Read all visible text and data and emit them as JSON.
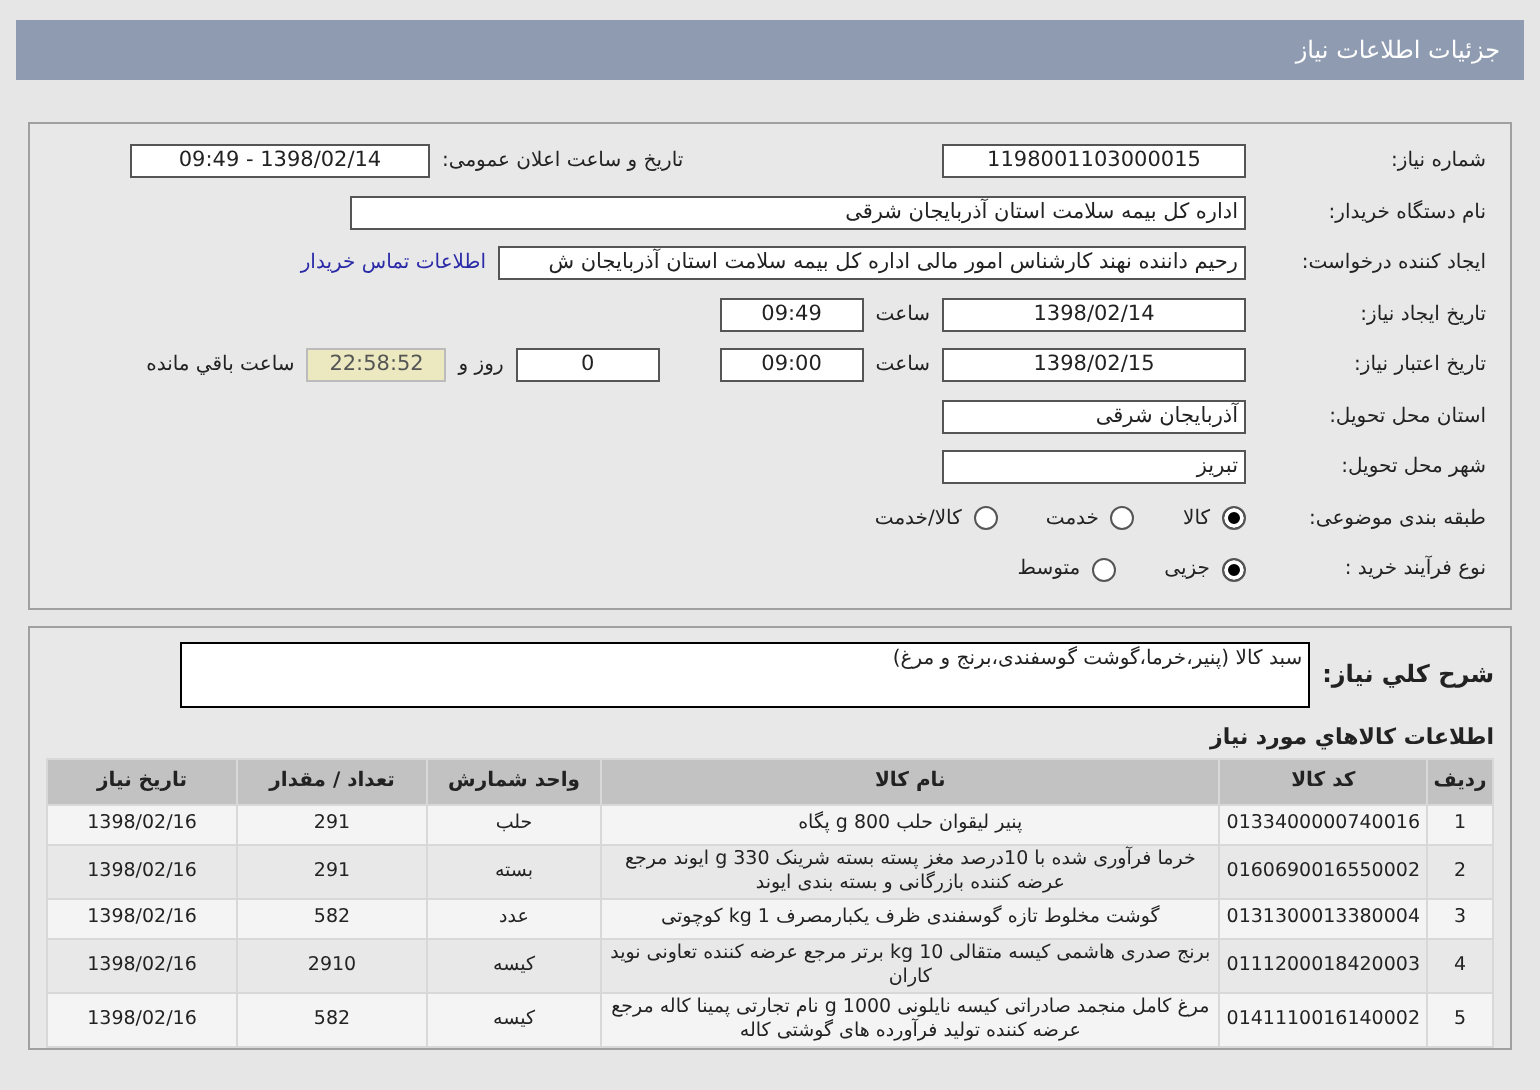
{
  "header": {
    "title": "جزئیات اطلاعات نیاز"
  },
  "details": {
    "need_number": {
      "label": "شماره نیاز:",
      "value": "1198001103000015"
    },
    "announce": {
      "label": "تاریخ و ساعت اعلان عمومی:",
      "value": "1398/02/14 - 09:49"
    },
    "buyer": {
      "label": "نام دستگاه خریدار:",
      "value": "اداره کل بیمه سلامت استان آذربایجان شرقی"
    },
    "creator": {
      "label": "ایجاد کننده درخواست:",
      "value": "رحیم  داننده نهند کارشناس امور مالی اداره کل بیمه سلامت استان آذربایجان ش",
      "link": "اطلاعات تماس خریدار"
    },
    "created": {
      "label": "تاریخ ایجاد نیاز:",
      "date": "1398/02/14",
      "time_label": "ساعت",
      "time": "09:49"
    },
    "valid": {
      "label": "تاریخ اعتبار نیاز:",
      "date": "1398/02/15",
      "time_label": "ساعت",
      "time": "09:00",
      "days": "0",
      "days_label": "روز و",
      "remaining": "22:58:52",
      "remaining_label": "ساعت باقي مانده"
    },
    "province": {
      "label": "استان محل تحویل:",
      "value": "آذربایجان شرقی"
    },
    "city": {
      "label": "شهر محل تحویل:",
      "value": "تبریز"
    },
    "category": {
      "label": "طبقه بندی موضوعی:",
      "options": [
        {
          "label": "کالا",
          "selected": true
        },
        {
          "label": "خدمت",
          "selected": false
        },
        {
          "label": "کالا/خدمت",
          "selected": false
        }
      ]
    },
    "process": {
      "label": "نوع فرآیند خرید :",
      "options": [
        {
          "label": "جزیی",
          "selected": true
        },
        {
          "label": "متوسط",
          "selected": false
        }
      ]
    }
  },
  "description": {
    "label": "شرح کلي نیاز:",
    "value": "سبد کالا (پنیر،خرما،گوشت گوسفندی،برنج و مرغ)"
  },
  "goods": {
    "title": "اطلاعات کالاهاي مورد نیاز",
    "columns": [
      "ردیف",
      "کد کالا",
      "نام کالا",
      "واحد شمارش",
      "تعداد / مقدار",
      "تاریخ نیاز"
    ],
    "rows": [
      [
        "1",
        "0133400000740016",
        "پنیر لیقوان حلب 800 g پگاه",
        "حلب",
        "291",
        "1398/02/16"
      ],
      [
        "2",
        "0160690016550002",
        "خرما فرآوری شده با 10درصد مغز پسته بسته شرینک 330 g ایوند مرجع عرضه کننده بازرگانی و بسته بندی ایوند",
        "بسته",
        "291",
        "1398/02/16"
      ],
      [
        "3",
        "0131300013380004",
        "گوشت مخلوط تازه گوسفندی ظرف یکبارمصرف 1 kg کوچوتی",
        "عدد",
        "582",
        "1398/02/16"
      ],
      [
        "4",
        "0111200018420003",
        "برنج صدری هاشمی کیسه متقالی 10 kg برتر مرجع عرضه کننده تعاونی نوید کاران",
        "کیسه",
        "2910",
        "1398/02/16"
      ],
      [
        "5",
        "0141110016140002",
        "مرغ کامل منجمد صادراتی کیسه نایلونی 1000 g نام تجارتی پمینا کاله مرجع عرضه کننده تولید فرآورده های گوشتی کاله",
        "کیسه",
        "582",
        "1398/02/16"
      ]
    ]
  }
}
